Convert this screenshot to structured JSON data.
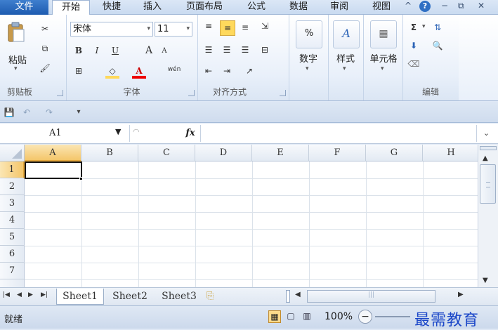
{
  "tabs": [
    "文件",
    "开始",
    "快捷",
    "插入",
    "页面布局",
    "公式",
    "数据",
    "审阅",
    "视图"
  ],
  "window_icons": [
    "^",
    "?",
    "−",
    "⧉",
    "✕"
  ],
  "clipboard": {
    "paste": "粘贴",
    "label": "剪贴板"
  },
  "font": {
    "name": "宋体",
    "size": "11",
    "label": "字体",
    "bold": "B",
    "italic": "I",
    "underline": "U",
    "grow": "A",
    "shrink": "A",
    "wen": "wén"
  },
  "align": {
    "label": "对齐方式"
  },
  "number": {
    "label": "数字",
    "symbol": "%"
  },
  "styles": {
    "label": "样式"
  },
  "cells": {
    "label": "单元格"
  },
  "editing": {
    "label": "编辑",
    "sum": "Σ"
  },
  "formula_bar": {
    "name_box": "A1",
    "fx": "fx",
    "value": ""
  },
  "columns": [
    "A",
    "B",
    "C",
    "D",
    "E",
    "F",
    "G",
    "H"
  ],
  "rows": [
    "1",
    "2",
    "3",
    "4",
    "5",
    "6",
    "7"
  ],
  "sheets": [
    "Sheet1",
    "Sheet2",
    "Sheet3"
  ],
  "status": {
    "ready": "就绪",
    "zoom": "100%",
    "zoom_minus": "−"
  },
  "watermark": "最需教育",
  "colors": {
    "accent": "#2b63b6",
    "highlight": "#ffd95c"
  }
}
